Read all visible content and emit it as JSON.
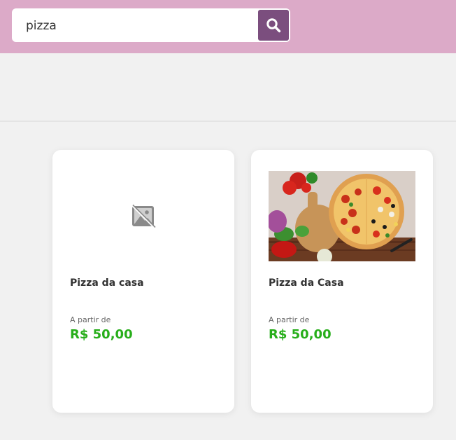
{
  "search": {
    "value": "pizza",
    "button_icon": "search-icon"
  },
  "colors": {
    "header_bg": "#dcaac8",
    "search_button": "#7b4e7e",
    "price": "#27ae1a"
  },
  "products": [
    {
      "image_icon": "image-unavailable-icon",
      "title": "Pizza da casa",
      "price_prefix": "A partir de",
      "price": "R$ 50,00"
    },
    {
      "image_icon": "pizza-photo",
      "title": "Pizza da Casa",
      "price_prefix": "A partir de",
      "price": "R$ 50,00"
    }
  ]
}
